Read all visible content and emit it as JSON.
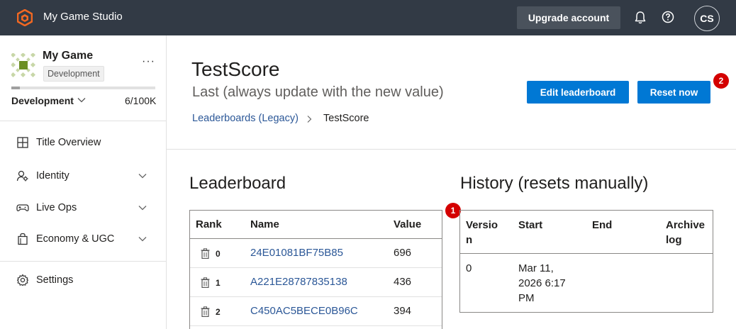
{
  "topbar": {
    "app_title": "My Game Studio",
    "upgrade_label": "Upgrade account",
    "avatar_initials": "CS",
    "bg_color": "#323a45",
    "logo_color": "#f26822"
  },
  "sidebar": {
    "game_name": "My Game",
    "environment_badge": "Development",
    "more_label": "···",
    "environment_select": "Development",
    "usage": "6/100K",
    "usage_fraction": 0.06,
    "nav_items": [
      {
        "label": "Title Overview",
        "icon": "grid-icon",
        "expandable": false
      },
      {
        "label": "Identity",
        "icon": "identity-icon",
        "expandable": true
      },
      {
        "label": "Live Ops",
        "icon": "gamepad-icon",
        "expandable": true
      },
      {
        "label": "Economy & UGC",
        "icon": "bag-icon",
        "expandable": true
      }
    ],
    "settings_label": "Settings"
  },
  "header": {
    "title": "TestScore",
    "subtitle": "Last (always update with the new value)",
    "edit_button": "Edit leaderboard",
    "reset_button": "Reset now",
    "accent_color": "#0078d4"
  },
  "breadcrumb": {
    "parent": "Leaderboards (Legacy)",
    "current": "TestScore"
  },
  "badges": {
    "one": "1",
    "two": "2"
  },
  "leaderboard": {
    "title": "Leaderboard",
    "columns": [
      "Rank",
      "Name",
      "Value"
    ],
    "rows": [
      {
        "rank": "0",
        "name": "24E01081BF75B85",
        "value": "696"
      },
      {
        "rank": "1",
        "name": "A221E28787835138",
        "value": "436"
      },
      {
        "rank": "2",
        "name": "C450AC5BECE0B96C",
        "value": "394"
      }
    ]
  },
  "history": {
    "title": "History (resets manually)",
    "columns": {
      "version_a": "Versio",
      "version_b": "n",
      "start": "Start",
      "end": "End",
      "archive_a": "Archive",
      "archive_b": "log"
    },
    "row": {
      "version": "0",
      "start_line1": "Mar 11,",
      "start_line2": "2026 6:17",
      "start_line3": "PM",
      "end": "",
      "archive": ""
    }
  }
}
